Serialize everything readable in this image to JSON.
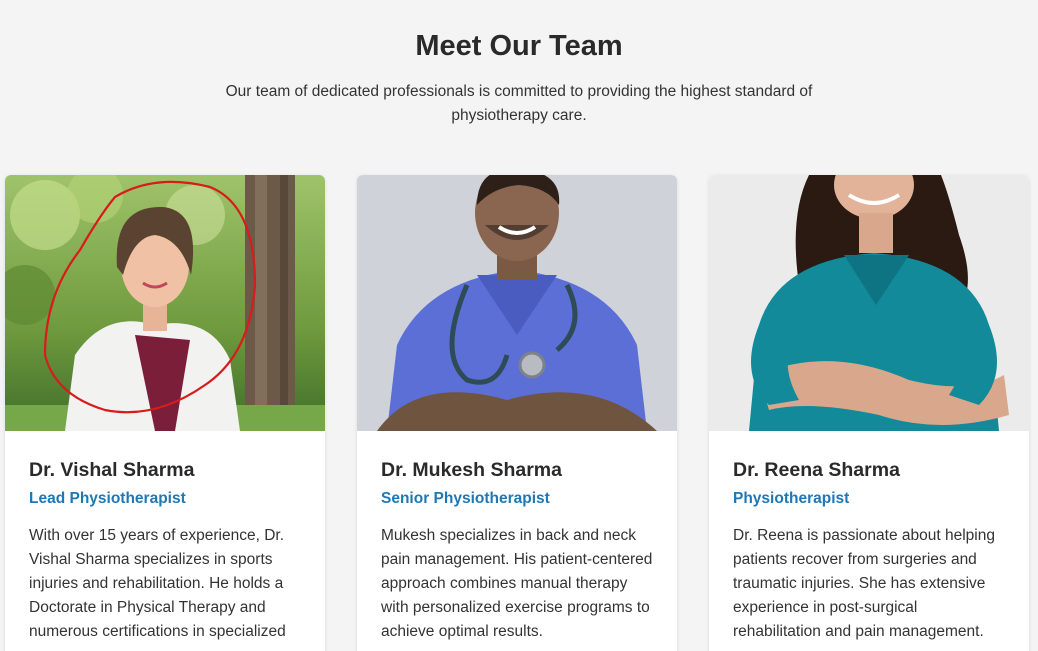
{
  "header": {
    "title": "Meet Our Team",
    "subtitle": "Our team of dedicated professionals is committed to providing the highest standard of physiotherapy care."
  },
  "team": [
    {
      "name": "Dr. Vishal Sharma",
      "role": "Lead Physiotherapist",
      "bio": "With over 15 years of experience, Dr. Vishal Sharma specializes in sports injuries and rehabilitation. He holds a Doctorate in Physical Therapy and numerous certifications in specialized"
    },
    {
      "name": "Dr. Mukesh Sharma",
      "role": "Senior Physiotherapist",
      "bio": "Mukesh specializes in back and neck pain management. His patient-centered approach combines manual therapy with personalized exercise programs to achieve optimal results."
    },
    {
      "name": "Dr. Reena Sharma",
      "role": "Physiotherapist",
      "bio": "Dr. Reena is passionate about helping patients recover from surgeries and traumatic injuries. She has extensive experience in post-surgical rehabilitation and pain management."
    }
  ],
  "colors": {
    "background": "#f4f4f4",
    "card": "#ffffff",
    "role_accent": "#1f78b4",
    "annotation": "#d81b1b"
  }
}
